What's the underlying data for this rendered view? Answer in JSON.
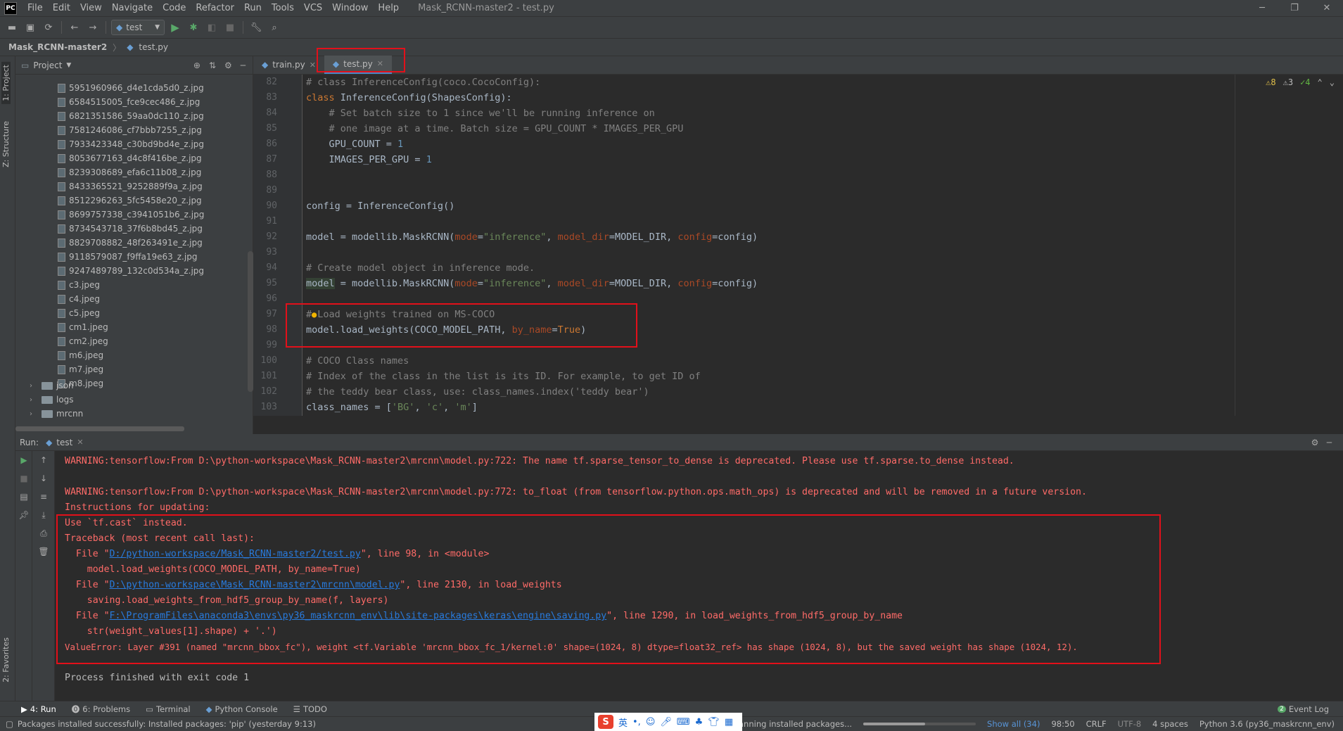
{
  "menubar": {
    "items": [
      "File",
      "Edit",
      "View",
      "Navigate",
      "Code",
      "Refactor",
      "Run",
      "Tools",
      "VCS",
      "Window",
      "Help"
    ],
    "window_title": "Mask_RCNN-master2 - test.py",
    "logo": "PC"
  },
  "toolbar": {
    "run_config": "test"
  },
  "breadcrumb": {
    "project": "Mask_RCNN-master2",
    "file": "test.py"
  },
  "left_strip": {
    "project_tab": "1: Project",
    "structure_tab": "Z: Structure",
    "favorites_tab": "2: Favorites"
  },
  "project_panel": {
    "title": "Project",
    "files": [
      "5951960966_d4e1cda5d0_z.jpg",
      "6584515005_fce9cec486_z.jpg",
      "6821351586_59aa0dc110_z.jpg",
      "7581246086_cf7bbb7255_z.jpg",
      "7933423348_c30bd9bd4e_z.jpg",
      "8053677163_d4c8f416be_z.jpg",
      "8239308689_efa6c11b08_z.jpg",
      "8433365521_9252889f9a_z.jpg",
      "8512296263_5fc5458e20_z.jpg",
      "8699757338_c3941051b6_z.jpg",
      "8734543718_37f6b8bd45_z.jpg",
      "8829708882_48f263491e_z.jpg",
      "9118579087_f9ffa19e63_z.jpg",
      "9247489789_132c0d534a_z.jpg",
      "c3.jpeg",
      "c4.jpeg",
      "c5.jpeg",
      "cm1.jpeg",
      "cm2.jpeg",
      "m6.jpeg",
      "m7.jpeg",
      "m8.jpeg"
    ],
    "folders": [
      "json",
      "logs",
      "mrcnn"
    ]
  },
  "editor": {
    "tabs": [
      {
        "label": "train.py"
      },
      {
        "label": "test.py"
      }
    ],
    "inspections": {
      "warnings": "8",
      "weak_warnings": "3",
      "ok": "4"
    },
    "line_numbers": [
      "82",
      "83",
      "84",
      "85",
      "86",
      "87",
      "88",
      "89",
      "90",
      "91",
      "92",
      "93",
      "94",
      "95",
      "96",
      "97",
      "98",
      "99",
      "100",
      "101",
      "102",
      "103"
    ]
  },
  "run_panel": {
    "label": "Run:",
    "tab": "test",
    "lines": {
      "l1": "WARNING:tensorflow:From D:\\python-workspace\\Mask_RCNN-master2\\mrcnn\\model.py:722: The name tf.sparse_tensor_to_dense is deprecated. Please use tf.sparse.to_dense instead.",
      "l3": "WARNING:tensorflow:From D:\\python-workspace\\Mask_RCNN-master2\\mrcnn\\model.py:772: to_float (from tensorflow.python.ops.math_ops) is deprecated and will be removed in a future version.",
      "l4": "Instructions for updating:",
      "l5": "Use `tf.cast` instead.",
      "l6": "Traceback (most recent call last):",
      "l7_pre": "  File \"",
      "l7_link": "D:/python-workspace/Mask_RCNN-master2/test.py",
      "l7_post": "\", line 98, in <module>",
      "l8": "    model.load_weights(COCO_MODEL_PATH, by_name=True)",
      "l9_pre": "  File \"",
      "l9_link": "D:\\python-workspace\\Mask_RCNN-master2\\mrcnn\\model.py",
      "l9_post": "\", line 2130, in load_weights",
      "l10": "    saving.load_weights_from_hdf5_group_by_name(f, layers)",
      "l11_pre": "  File \"",
      "l11_link": "F:\\ProgramFiles\\anaconda3\\envs\\py36_maskrcnn_env\\lib\\site-packages\\keras\\engine\\saving.py",
      "l11_post": "\", line 1290, in load_weights_from_hdf5_group_by_name",
      "l12": "    str(weight_values[1].shape) + '.')",
      "l13": "ValueError: Layer #391 (named \"mrcnn_bbox_fc\"), weight <tf.Variable 'mrcnn_bbox_fc_1/kernel:0' shape=(1024, 8) dtype=float32_ref> has shape (1024, 8), but the saved weight has shape (1024, 12).",
      "l15": "Process finished with exit code 1"
    }
  },
  "bottom_tabs": {
    "run": "4: Run",
    "problems": "6: Problems",
    "terminal": "Terminal",
    "python_console": "Python Console",
    "todo": "TODO",
    "event_log": "Event Log",
    "event_count": "2"
  },
  "status": {
    "message": "Packages installed successfully: Installed packages: 'pip' (yesterday 9:13)",
    "scanning": "Scanning installed packages...",
    "scan_progress": 0.55,
    "show_all": "Show all (34)",
    "position": "98:50",
    "line_sep": "CRLF",
    "encoding": "UTF-8",
    "indent": "4 spaces",
    "interpreter": "Python 3.6 (py36_maskrcnn_env)"
  },
  "ime": {
    "logo": "S",
    "lang": "英"
  },
  "colors": {
    "accent_red": "#e2101a",
    "link": "#287bde",
    "error": "#ff6b68"
  }
}
